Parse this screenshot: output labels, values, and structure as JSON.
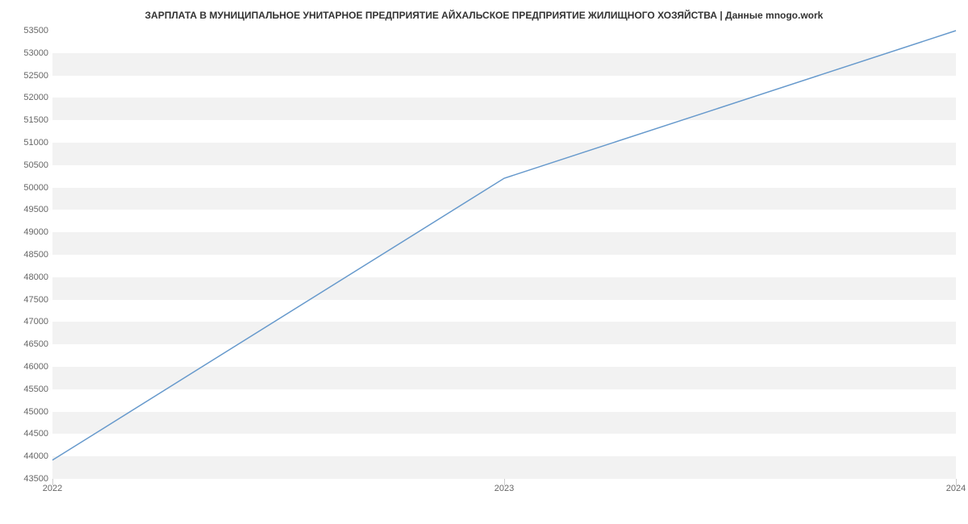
{
  "chart_data": {
    "type": "line",
    "title": "ЗАРПЛАТА В МУНИЦИПАЛЬНОЕ УНИТАРНОЕ ПРЕДПРИЯТИЕ АЙХАЛЬСКОЕ ПРЕДПРИЯТИЕ ЖИЛИЩНОГО ХОЗЯЙСТВА | Данные mnogo.work",
    "x": [
      2022,
      2023,
      2024
    ],
    "values": [
      43900,
      50200,
      53500
    ],
    "xlabel": "",
    "ylabel": "",
    "ylim": [
      43500,
      53500
    ],
    "xlim": [
      2022,
      2024
    ],
    "y_ticks": [
      43500,
      44000,
      44500,
      45000,
      45500,
      46000,
      46500,
      47000,
      47500,
      48000,
      48500,
      49000,
      49500,
      50000,
      50500,
      51000,
      51500,
      52000,
      52500,
      53000,
      53500
    ],
    "x_ticks": [
      2022,
      2023,
      2024
    ],
    "line_color": "#6699cc",
    "band_color": "#f2f2f2"
  }
}
